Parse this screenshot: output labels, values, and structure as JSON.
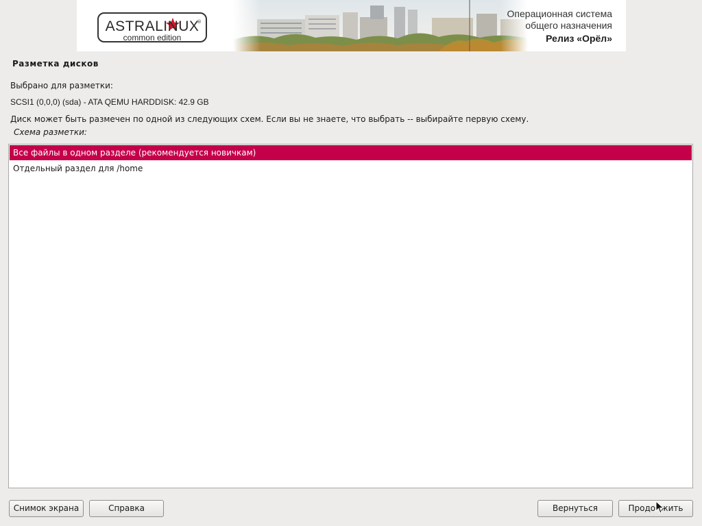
{
  "banner": {
    "logo_main": "ASTRALINUX",
    "logo_reg": "®",
    "logo_sub": "common edition",
    "os_line1": "Операционная система",
    "os_line2": "общего назначения",
    "release": "Релиз «Орёл»",
    "star_color": "#d4142a",
    "icons": [
      "star-icon"
    ]
  },
  "page": {
    "title": "Разметка дисков",
    "selected_label": "Выбрано для разметки:",
    "disk": "SCSI1 (0,0,0) (sda) - ATA QEMU HARDDISK: 42.9 GB",
    "description": "Диск может быть размечен по одной из следующих схем. Если вы не знаете, что выбрать -- выбирайте первую схему.",
    "scheme_label": "Схема разметки:"
  },
  "schemes": {
    "items": [
      {
        "label": "Все файлы в одном разделе (рекомендуется новичкам)",
        "selected": true
      },
      {
        "label": "Отдельный раздел для /home",
        "selected": false
      }
    ],
    "selection_color": "#c5004a"
  },
  "buttons": {
    "screenshot": "Снимок экрана",
    "help": "Справка",
    "back": "Вернуться",
    "continue": "Продолжить"
  }
}
